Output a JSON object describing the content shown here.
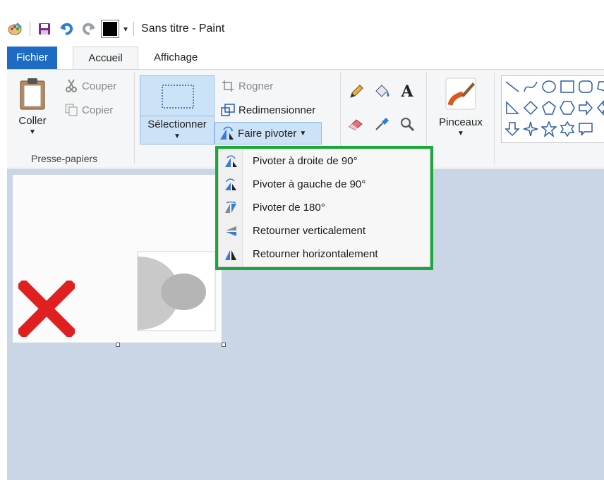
{
  "window": {
    "title": "Sans titre - Paint"
  },
  "tabs": {
    "file": "Fichier",
    "home": "Accueil",
    "view": "Affichage"
  },
  "clipboard": {
    "paste": "Coller",
    "cut": "Couper",
    "copy": "Copier",
    "group_label": "Presse-papiers"
  },
  "image": {
    "select": "Sélectionner",
    "crop": "Rogner",
    "resize": "Redimensionner",
    "rotate": "Faire pivoter"
  },
  "brushes": {
    "label": "Pinceaux"
  },
  "rotate_menu": {
    "items": [
      {
        "label": "Pivoter à droite de 90°"
      },
      {
        "label": "Pivoter à gauche de 90°"
      },
      {
        "label": "Pivoter de 180°"
      },
      {
        "label": "Retourner verticalement"
      },
      {
        "label": "Retourner horizontalement"
      }
    ]
  },
  "colors": {
    "accent": "#1e6bc4",
    "highlight_border": "#1aa83a",
    "selected": "#cce2f7",
    "workspace": "#cad6e5",
    "primary_color": "#000000",
    "red_x": "#e02020"
  }
}
